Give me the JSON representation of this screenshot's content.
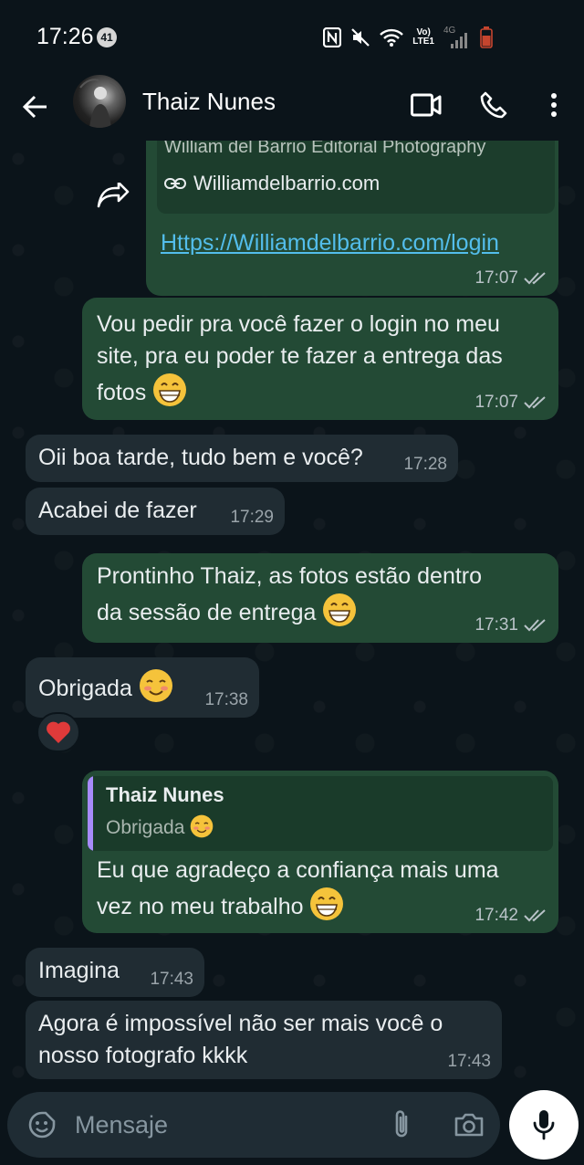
{
  "status_bar": {
    "time": "17:26",
    "notification_count": "41",
    "network_label_top": "Vo)",
    "network_label_bottom": "LTE1",
    "network_type": "4G",
    "icons": [
      "nfc-icon",
      "mute-icon",
      "wifi-icon",
      "signal-icon",
      "battery-icon"
    ]
  },
  "header": {
    "contact_name": "Thaiz Nunes",
    "icons": [
      "back-arrow-icon",
      "video-call-icon",
      "phone-call-icon",
      "more-vert-icon"
    ]
  },
  "colors": {
    "background": "#0b141a",
    "outgoing_bubble": "#234a35",
    "incoming_bubble": "#202c33",
    "link": "#53bdeb",
    "reply_bar": "#a78bfa"
  },
  "messages": [
    {
      "direction": "out",
      "forwarded": true,
      "link_preview_site": "William del Barrio Editorial Photography",
      "link_preview_domain": "Williamdelbarrio.com",
      "text": "Https://Williamdelbarrio.com/login",
      "time": "17:07",
      "status": "read"
    },
    {
      "direction": "out",
      "text": "Vou pedir pra você fazer o login no meu site, pra eu poder te fazer a entrega das fotos",
      "line1": "Vou pedir pra você fazer o login no meu",
      "line2": "site, pra eu poder te fazer a entrega das",
      "line3": "fotos",
      "emoji": "grinning-face",
      "time": "17:07",
      "status": "read"
    },
    {
      "direction": "in",
      "text": "Oii boa tarde, tudo bem e você?",
      "time": "17:28"
    },
    {
      "direction": "in",
      "text": "Acabei de fazer",
      "time": "17:29"
    },
    {
      "direction": "out",
      "line1": "Prontinho Thaiz, as fotos estão dentro",
      "line2": "da sessão de entrega",
      "emoji": "grinning-face",
      "time": "17:31",
      "status": "read"
    },
    {
      "direction": "in",
      "text": "Obrigada",
      "emoji": "smiling-face",
      "time": "17:38",
      "reaction": "red-heart"
    },
    {
      "direction": "out",
      "reply_author": "Thaiz Nunes",
      "reply_text": "Obrigada",
      "line1": "Eu que agradeço a confiança mais uma",
      "line2": "vez no meu trabalho",
      "emoji": "grinning-face",
      "time": "17:42",
      "status": "read"
    },
    {
      "direction": "in",
      "text": "Imagina",
      "time": "17:43"
    },
    {
      "direction": "in",
      "line1": "Agora é impossível não ser mais você o",
      "line2": "nosso fotografo kkkk",
      "time": "17:43"
    }
  ],
  "composer": {
    "placeholder": "Mensaje",
    "icons": [
      "emoji-icon",
      "attach-icon",
      "camera-icon",
      "mic-icon"
    ]
  }
}
